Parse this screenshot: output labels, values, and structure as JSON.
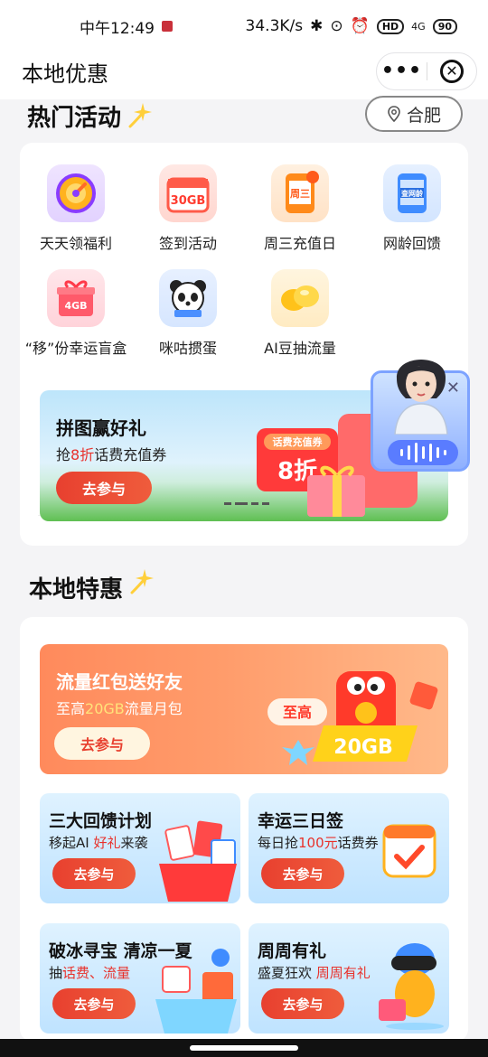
{
  "status_bar": {
    "time": "中午12:49",
    "network_speed": "34.3K/s",
    "signal": "4G",
    "battery": "90",
    "hd": "HD"
  },
  "title_bar": {
    "title": "本地优惠",
    "more_icon": "ellipsis-icon",
    "close_icon": "close-circle-icon"
  },
  "hot_section": {
    "title": "热门活动",
    "city": "合肥",
    "items": [
      {
        "label": "天天领福利",
        "icon": "wheel-icon",
        "color": "#b983ff"
      },
      {
        "label": "签到活动",
        "icon": "calendar-30gb-icon",
        "color": "#ff6a5c",
        "badge": "30GB"
      },
      {
        "label": "周三充值日",
        "icon": "phone-wednesday-icon",
        "color": "#ff8a2a",
        "badge": "周三"
      },
      {
        "label": "网龄回馈",
        "icon": "phone-age-icon",
        "color": "#3f8cff",
        "badge": "查网龄"
      },
      {
        "label": "“移”份幸运盲盒",
        "icon": "gift-4gb-icon",
        "color": "#ff5a6a",
        "badge": "4GB"
      },
      {
        "label": "咪咕掼蛋",
        "icon": "panda-icon",
        "color": "#4a8fff"
      },
      {
        "label": "AI豆抽流量",
        "icon": "golden-bean-icon",
        "color": "#ffc21a"
      }
    ],
    "banner": {
      "title": "拼图赢好礼",
      "subtitle_prefix": "抢",
      "subtitle_highlight": "8折",
      "subtitle_suffix": "话费充值券",
      "button": "去参与",
      "coupon_tag": "话费充值券",
      "coupon_value": "8折"
    }
  },
  "local_section": {
    "title": "本地特惠",
    "banner": {
      "title": "流量红包送好友",
      "subtitle_prefix": "至高",
      "subtitle_highlight": "20GB",
      "subtitle_suffix": "流量月包",
      "button": "去参与",
      "tag_top": "至高",
      "tag_value": "20GB"
    },
    "tiles": [
      {
        "title": "三大回馈计划",
        "sub_prefix": "移起AI ",
        "sub_highlight": "好礼",
        "sub_suffix": "来袭",
        "button": "去参与"
      },
      {
        "title": "幸运三日签",
        "sub_prefix": "每日抢",
        "sub_highlight": "100元",
        "sub_suffix": "话费券",
        "button": "去参与"
      },
      {
        "title": "破冰寻宝 清凉一夏",
        "sub_prefix": "抽",
        "sub_highlight": "话费、流量",
        "sub_suffix": "",
        "button": "去参与"
      },
      {
        "title": "周周有礼",
        "sub_prefix": "盛夏狂欢 ",
        "sub_highlight": "周周有礼",
        "sub_suffix": "",
        "button": "去参与"
      }
    ]
  }
}
